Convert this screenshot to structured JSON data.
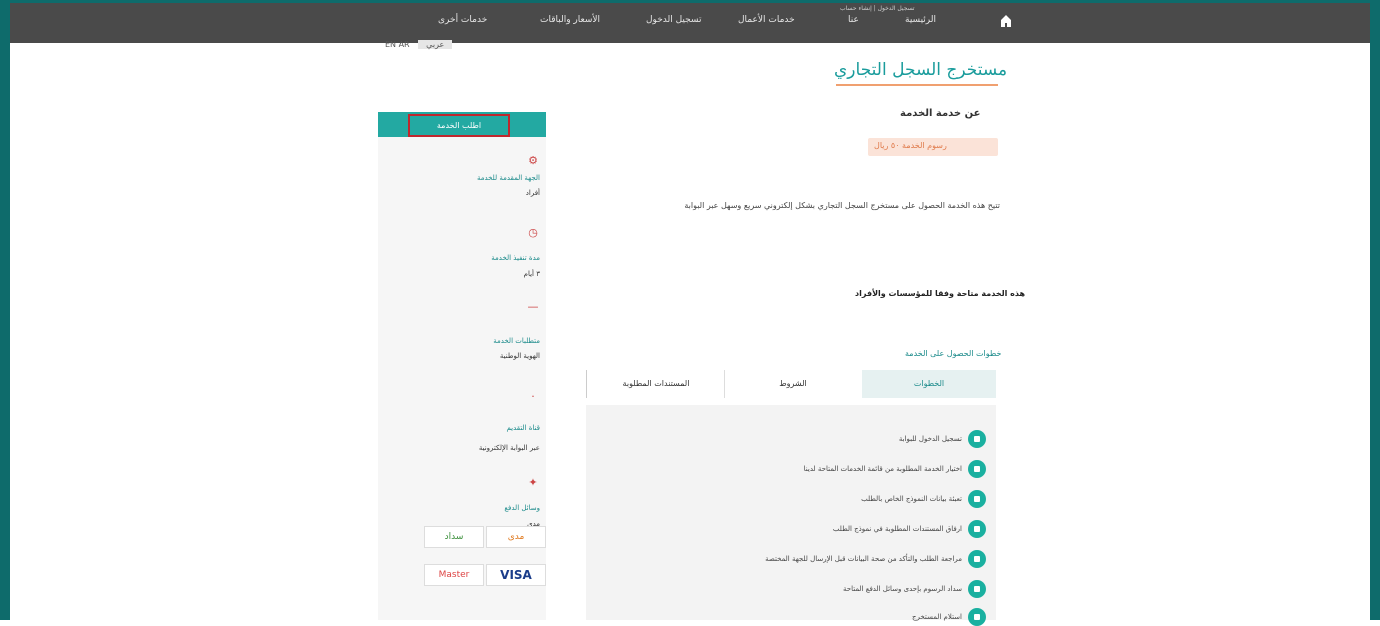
{
  "topbar": {
    "nav": [
      "خدمات أخرى",
      "الأسعار والباقات",
      "تسجيل الدخول",
      "خدمات الأعمال",
      "عنا",
      "الرئيسية"
    ],
    "home_icon": "home-icon",
    "login_hint": "تسجيل الدخول | إنشاء حساب"
  },
  "lang": {
    "label": "EN  AR",
    "pill": "عربي"
  },
  "page": {
    "title": "مستخرج السجل التجاري",
    "section_head": "عن خدمة الخدمة",
    "tag": "رسوم الخدمة ٥٠ ريال",
    "paragraph": "تتيح هذه الخدمة الحصول على مستخرج السجل التجاري بشكل إلكتروني سريع وسهل عبر البوابة",
    "bold_line": "هذه الخدمة متاحة وفقا للمؤسسات والأفراد",
    "services_label": "خطوات الحصول على الخدمة"
  },
  "tabs": [
    "الخطوات",
    "الشروط",
    "المستندات المطلوبة"
  ],
  "list_items": [
    "تسجيل الدخول للبوابة",
    "اختيار الخدمة المطلوبة من قائمة الخدمات المتاحة لدينا",
    "تعبئة بيانات النموذج الخاص بالطلب",
    "ارفاق المستندات المطلوبة في نموذج الطلب",
    "مراجعة الطلب والتأكد من صحة البيانات قبل الإرسال للجهة المختصة",
    "سداد الرسوم بإحدى وسائل الدفع المتاحة",
    "استلام المستخرج"
  ],
  "sidebar": {
    "button": "اطلب الخدمة",
    "items": [
      {
        "label": "الجهة المقدمة للخدمة",
        "value": "أفراد"
      },
      {
        "label": "مدة تنفيذ الخدمة",
        "value": "٣ أيام"
      },
      {
        "label": "متطلبات الخدمة",
        "value": "الهوية الوطنية"
      },
      {
        "label": "قناة التقديم",
        "value": "عبر البوابة الإلكترونية"
      },
      {
        "label": "وسائل الدفع",
        "value": "مدى"
      }
    ],
    "payments": [
      "مدى",
      "سداد",
      "VISA",
      "Master"
    ]
  },
  "colors": {
    "topbar": "#4a4a4a",
    "accent": "#23a9a2",
    "title": "#1a9c9c",
    "underline": "#f0a070",
    "highlight_box": "#c0272d"
  }
}
